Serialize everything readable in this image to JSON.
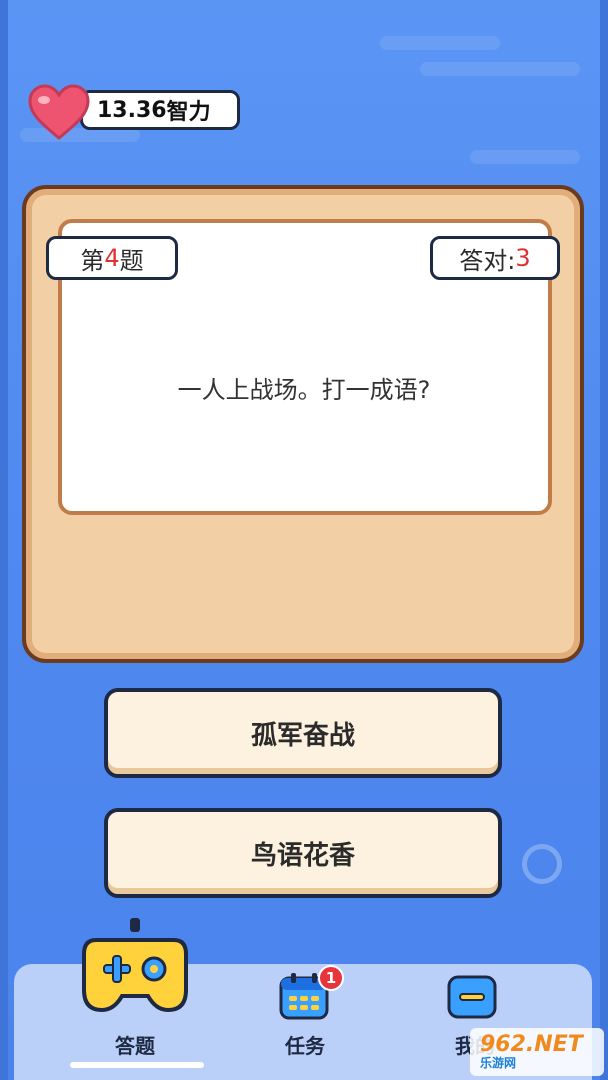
{
  "header": {
    "iq_value": "13.36",
    "iq_unit": "智力"
  },
  "board": {
    "question_prefix": "第",
    "question_number": "4",
    "question_suffix": "题",
    "correct_label": "答对:",
    "correct_count": "3",
    "question_text": "一人上战场。打一成语?"
  },
  "answers": [
    {
      "label": "孤军奋战"
    },
    {
      "label": "鸟语花香"
    }
  ],
  "tabbar": {
    "tabs": [
      {
        "label": "答题",
        "icon": "gamepad-icon"
      },
      {
        "label": "任务",
        "icon": "calendar-icon",
        "badge": "1"
      },
      {
        "label": "我的",
        "icon": "wallet-icon"
      }
    ]
  },
  "watermark": {
    "top": "962.NET",
    "bottom": "乐游网"
  },
  "colors": {
    "accent_red": "#e03030",
    "background_blue": "#5b95f4",
    "board_tan": "#f3cfa5"
  }
}
